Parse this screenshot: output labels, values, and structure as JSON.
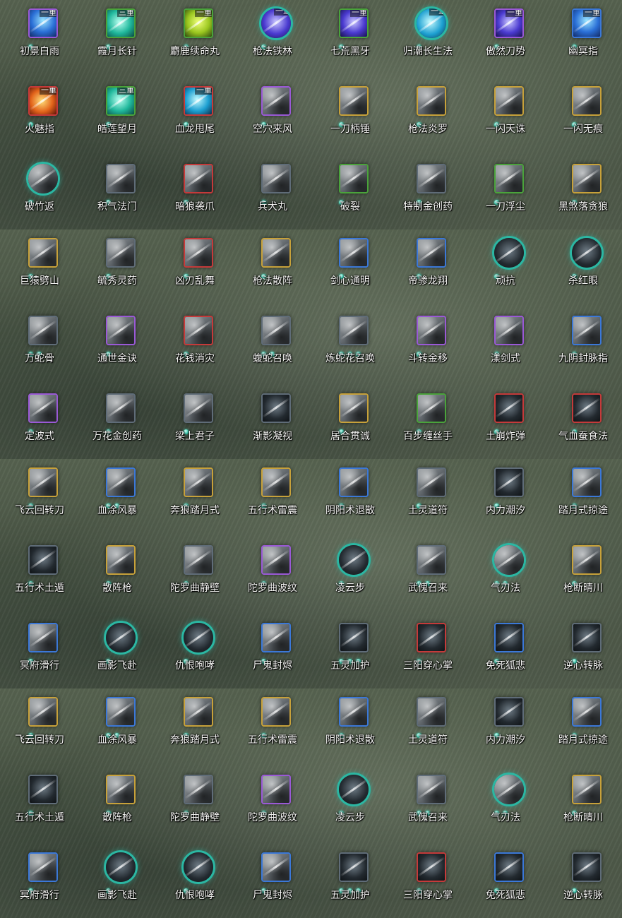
{
  "blocks": [
    {
      "rows": [
        [
          {
            "name": "初景白雨",
            "tier": "一重",
            "frame": "purple",
            "art": "c-blue",
            "dots": 1
          },
          {
            "name": "霞月长针",
            "tier": "三重",
            "frame": "green",
            "art": "c-teal",
            "dots": 1
          },
          {
            "name": "麝鹿续命丸",
            "tier": "一重",
            "frame": "green",
            "art": "c-lime",
            "dots": 1
          },
          {
            "name": "枪法铁林",
            "tier": "一重",
            "frame": "round",
            "art": "c-violet",
            "dots": 1
          },
          {
            "name": "七荒黑牙",
            "tier": "一重",
            "frame": "green",
            "art": "c-violet",
            "dots": 1
          },
          {
            "name": "归潮长生法",
            "tier": "一重",
            "frame": "round",
            "art": "c-cyan",
            "dots": 1
          },
          {
            "name": "傲然刀势",
            "tier": "一重",
            "frame": "purple",
            "art": "c-violet",
            "dots": 1
          },
          {
            "name": "幽冥指",
            "tier": "一重",
            "frame": "blue",
            "art": "c-blue",
            "dots": 1
          }
        ],
        [
          {
            "name": "火魅指",
            "tier": "一重",
            "frame": "red",
            "art": "c-fire",
            "dots": 1
          },
          {
            "name": "皓莲望月",
            "tier": "三重",
            "frame": "green",
            "art": "c-teal",
            "dots": 1
          },
          {
            "name": "血龙甩尾",
            "tier": "一重",
            "frame": "red",
            "art": "c-cyan",
            "dots": 1
          },
          {
            "name": "空穴来风",
            "tier": "",
            "frame": "purple",
            "art": "bw",
            "dots": 1
          },
          {
            "name": "一刀柄锤",
            "tier": "",
            "frame": "gold",
            "art": "bw",
            "dots": 1
          },
          {
            "name": "枪法炎罗",
            "tier": "",
            "frame": "gold",
            "art": "bw",
            "dots": 1
          },
          {
            "name": "一闪天诛",
            "tier": "",
            "frame": "gold",
            "art": "bw",
            "dots": 1
          },
          {
            "name": "一闪无痕",
            "tier": "",
            "frame": "gold",
            "art": "bw",
            "dots": 1
          }
        ],
        [
          {
            "name": "破竹返",
            "tier": "",
            "frame": "round",
            "art": "bw",
            "dots": 1
          },
          {
            "name": "积气法门",
            "tier": "",
            "frame": "gray",
            "art": "bw",
            "dots": 1
          },
          {
            "name": "暗狼袭爪",
            "tier": "",
            "frame": "red",
            "art": "bw",
            "dots": 1
          },
          {
            "name": "兵犬丸",
            "tier": "",
            "frame": "gray",
            "art": "bw",
            "dots": 1
          },
          {
            "name": "破裂",
            "tier": "",
            "frame": "green",
            "art": "bw",
            "dots": 1
          },
          {
            "name": "特制金创药",
            "tier": "",
            "frame": "gray",
            "art": "bw",
            "dots": 1
          },
          {
            "name": "一刀浮尘",
            "tier": "",
            "frame": "green",
            "art": "bw",
            "dots": 1
          },
          {
            "name": "黑煞落贪狼",
            "tier": "",
            "frame": "gold",
            "art": "bw",
            "dots": 1
          }
        ]
      ]
    },
    {
      "rows": [
        [
          {
            "name": "巨猿劈山",
            "tier": "",
            "frame": "gold",
            "art": "bw",
            "dots": 1
          },
          {
            "name": "毓秀灵药",
            "tier": "",
            "frame": "gray",
            "art": "bw",
            "dots": 1
          },
          {
            "name": "凶刃乱舞",
            "tier": "",
            "frame": "red",
            "art": "bw",
            "dots": 1
          },
          {
            "name": "枪法散阵",
            "tier": "",
            "frame": "gold",
            "art": "bw",
            "dots": 1
          },
          {
            "name": "剑心通明",
            "tier": "",
            "frame": "blue",
            "art": "bw",
            "dots": 1
          },
          {
            "name": "帝骖龙翔",
            "tier": "",
            "frame": "blue",
            "art": "bw",
            "dots": 1
          },
          {
            "name": "顽抗",
            "tier": "",
            "frame": "round",
            "art": "c-dark",
            "dots": 1
          },
          {
            "name": "杀红眼",
            "tier": "",
            "frame": "round",
            "art": "c-dark",
            "dots": 1
          }
        ],
        [
          {
            "name": "万蛇骨",
            "tier": "",
            "frame": "gray",
            "art": "bw",
            "dots": 2
          },
          {
            "name": "通世金诀",
            "tier": "",
            "frame": "purple",
            "art": "bw",
            "dots": 1
          },
          {
            "name": "花钱消灾",
            "tier": "",
            "frame": "red",
            "art": "bw",
            "dots": 1
          },
          {
            "name": "蝮蛇召唤",
            "tier": "",
            "frame": "gray",
            "art": "bw",
            "dots": 2
          },
          {
            "name": "炼蛇花召唤",
            "tier": "",
            "frame": "gray",
            "art": "bw",
            "dots": 3
          },
          {
            "name": "斗转金移",
            "tier": "",
            "frame": "purple",
            "art": "bw",
            "dots": 1
          },
          {
            "name": "漾剑式",
            "tier": "",
            "frame": "purple",
            "art": "bw",
            "dots": 1
          },
          {
            "name": "九阴封脉指",
            "tier": "",
            "frame": "blue",
            "art": "bw",
            "dots": 1
          }
        ],
        [
          {
            "name": "定波式",
            "tier": "",
            "frame": "purple",
            "art": "bw",
            "dots": 1
          },
          {
            "name": "万花金创药",
            "tier": "",
            "frame": "gray",
            "art": "bw",
            "dots": 1
          },
          {
            "name": "梁上君子",
            "tier": "",
            "frame": "gray",
            "art": "bw",
            "dots": 1
          },
          {
            "name": "渐影凝视",
            "tier": "",
            "frame": "gray",
            "art": "c-dark",
            "dots": 0
          },
          {
            "name": "居合贯诚",
            "tier": "",
            "frame": "gold",
            "art": "bw",
            "dots": 1
          },
          {
            "name": "百步缠丝手",
            "tier": "",
            "frame": "green",
            "art": "bw",
            "dots": 1
          },
          {
            "name": "土崩炸弹",
            "tier": "",
            "frame": "red",
            "art": "c-dark",
            "dots": 1
          },
          {
            "name": "气血蚕食法",
            "tier": "",
            "frame": "red",
            "art": "c-dark",
            "dots": 1
          }
        ]
      ]
    },
    {
      "rows": [
        [
          {
            "name": "飞云回转刀",
            "tier": "",
            "frame": "gold",
            "art": "bw",
            "dots": 1
          },
          {
            "name": "血涂风暴",
            "tier": "",
            "frame": "blue",
            "art": "bw",
            "dots": 2
          },
          {
            "name": "奔狼踏月式",
            "tier": "",
            "frame": "gold",
            "art": "bw",
            "dots": 1
          },
          {
            "name": "五行术雷震",
            "tier": "",
            "frame": "gold",
            "art": "bw",
            "dots": 1
          },
          {
            "name": "阴阳术退散",
            "tier": "",
            "frame": "blue",
            "art": "bw",
            "dots": 1
          },
          {
            "name": "土灵道符",
            "tier": "",
            "frame": "gray",
            "art": "bw",
            "dots": 1
          },
          {
            "name": "内力潮汐",
            "tier": "",
            "frame": "gray",
            "art": "c-dark",
            "dots": 1
          },
          {
            "name": "踏月式掠途",
            "tier": "",
            "frame": "blue",
            "art": "bw",
            "dots": 1
          }
        ],
        [
          {
            "name": "五行术土遁",
            "tier": "",
            "frame": "gray",
            "art": "c-dark",
            "dots": 1
          },
          {
            "name": "散阵枪",
            "tier": "",
            "frame": "gold",
            "art": "bw",
            "dots": 1
          },
          {
            "name": "陀罗曲静壁",
            "tier": "",
            "frame": "gray",
            "art": "bw",
            "dots": 1
          },
          {
            "name": "陀罗曲波纹",
            "tier": "",
            "frame": "purple",
            "art": "bw",
            "dots": 1
          },
          {
            "name": "凌云步",
            "tier": "",
            "frame": "round",
            "art": "c-dark",
            "dots": 1
          },
          {
            "name": "武傀召来",
            "tier": "",
            "frame": "gray",
            "art": "bw",
            "dots": 2
          },
          {
            "name": "气刃法",
            "tier": "",
            "frame": "round",
            "art": "bw",
            "dots": 2
          },
          {
            "name": "枪断晴川",
            "tier": "",
            "frame": "gold",
            "art": "bw",
            "dots": 1
          }
        ],
        [
          {
            "name": "冥府滑行",
            "tier": "",
            "frame": "blue",
            "art": "bw",
            "dots": 1
          },
          {
            "name": "画影飞赴",
            "tier": "",
            "frame": "round",
            "art": "c-dark",
            "dots": 1
          },
          {
            "name": "仇恨咆哮",
            "tier": "",
            "frame": "round",
            "art": "c-dark",
            "dots": 1
          },
          {
            "name": "尸鬼封烬",
            "tier": "",
            "frame": "blue",
            "art": "bw",
            "dots": 1
          },
          {
            "name": "五灵加护",
            "tier": "",
            "frame": "gray",
            "art": "c-dark",
            "dots": 3
          },
          {
            "name": "三阳穿心掌",
            "tier": "",
            "frame": "red",
            "art": "c-dark",
            "dots": 1
          },
          {
            "name": "免死狐悲",
            "tier": "",
            "frame": "blue",
            "art": "c-dark",
            "dots": 1
          },
          {
            "name": "逆心转脉",
            "tier": "",
            "frame": "gray",
            "art": "c-dark",
            "dots": 1
          }
        ]
      ]
    },
    {
      "rows": [
        [
          {
            "name": "飞云回转刀",
            "tier": "",
            "frame": "gold",
            "art": "bw",
            "dots": 1
          },
          {
            "name": "血涂风暴",
            "tier": "",
            "frame": "blue",
            "art": "bw",
            "dots": 2
          },
          {
            "name": "奔狼踏月式",
            "tier": "",
            "frame": "gold",
            "art": "bw",
            "dots": 1
          },
          {
            "name": "五行术雷震",
            "tier": "",
            "frame": "gold",
            "art": "bw",
            "dots": 1
          },
          {
            "name": "阴阳术退散",
            "tier": "",
            "frame": "blue",
            "art": "bw",
            "dots": 1
          },
          {
            "name": "土灵道符",
            "tier": "",
            "frame": "gray",
            "art": "bw",
            "dots": 1
          },
          {
            "name": "内力潮汐",
            "tier": "",
            "frame": "gray",
            "art": "c-dark",
            "dots": 1
          },
          {
            "name": "踏月式掠途",
            "tier": "",
            "frame": "blue",
            "art": "bw",
            "dots": 1
          }
        ],
        [
          {
            "name": "五行术土遁",
            "tier": "",
            "frame": "gray",
            "art": "c-dark",
            "dots": 1
          },
          {
            "name": "散阵枪",
            "tier": "",
            "frame": "gold",
            "art": "bw",
            "dots": 1
          },
          {
            "name": "陀罗曲静壁",
            "tier": "",
            "frame": "gray",
            "art": "bw",
            "dots": 1
          },
          {
            "name": "陀罗曲波纹",
            "tier": "",
            "frame": "purple",
            "art": "bw",
            "dots": 1
          },
          {
            "name": "凌云步",
            "tier": "",
            "frame": "round",
            "art": "c-dark",
            "dots": 1
          },
          {
            "name": "武傀召来",
            "tier": "",
            "frame": "gray",
            "art": "bw",
            "dots": 2
          },
          {
            "name": "气刃法",
            "tier": "",
            "frame": "round",
            "art": "bw",
            "dots": 2
          },
          {
            "name": "枪断晴川",
            "tier": "",
            "frame": "gold",
            "art": "bw",
            "dots": 1
          }
        ],
        [
          {
            "name": "冥府滑行",
            "tier": "",
            "frame": "blue",
            "art": "bw",
            "dots": 1
          },
          {
            "name": "画影飞赴",
            "tier": "",
            "frame": "round",
            "art": "c-dark",
            "dots": 1
          },
          {
            "name": "仇恨咆哮",
            "tier": "",
            "frame": "round",
            "art": "c-dark",
            "dots": 1
          },
          {
            "name": "尸鬼封烬",
            "tier": "",
            "frame": "blue",
            "art": "bw",
            "dots": 1
          },
          {
            "name": "五灵加护",
            "tier": "",
            "frame": "gray",
            "art": "c-dark",
            "dots": 3
          },
          {
            "name": "三阳穿心掌",
            "tier": "",
            "frame": "red",
            "art": "c-dark",
            "dots": 1
          },
          {
            "name": "免死狐悲",
            "tier": "",
            "frame": "blue",
            "art": "c-dark",
            "dots": 1
          },
          {
            "name": "逆心转脉",
            "tier": "",
            "frame": "gray",
            "art": "c-dark",
            "dots": 1
          }
        ]
      ]
    }
  ]
}
